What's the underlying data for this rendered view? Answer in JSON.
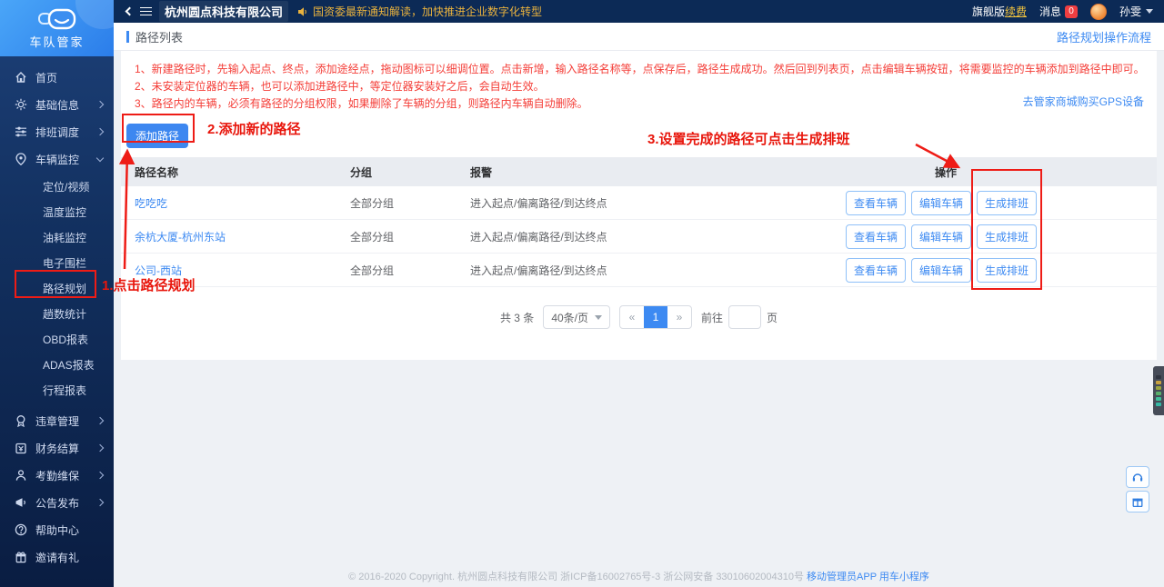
{
  "colors": {
    "accent_blue": "#3d8af2",
    "topbar_navy": "#0c2a56",
    "sidebar_blue": "#12305f",
    "annotation_red": "#ee1c16",
    "tip_red": "#f43d37",
    "marquee_yellow": "#e9b23e",
    "badge_red": "#f03e41"
  },
  "logo": {
    "title": "车队管家"
  },
  "topbar": {
    "company": "杭州圆点科技有限公司",
    "announcement": "国资委最新通知解读，加快推进企业数字化转型",
    "version_label": "旗舰版",
    "renew_link": "续费",
    "messages_label": "消息",
    "messages_count": "0",
    "user_name": "孙雯"
  },
  "sidebar": {
    "items": [
      {
        "label": "首页",
        "icon": "home-icon"
      },
      {
        "label": "基础信息",
        "icon": "gear-icon"
      },
      {
        "label": "排班调度",
        "icon": "sliders-icon"
      },
      {
        "label": "车辆监控",
        "icon": "location-pin-icon"
      },
      {
        "label": "违章管理",
        "icon": "violation-badge-icon"
      },
      {
        "label": "财务结算",
        "icon": "finance-icon"
      },
      {
        "label": "考勤维保",
        "icon": "person-icon"
      },
      {
        "label": "公告发布",
        "icon": "megaphone-icon"
      },
      {
        "label": "帮助中心",
        "icon": "help-icon"
      },
      {
        "label": "邀请有礼",
        "icon": "gift-icon"
      }
    ],
    "vehicle_submenu": [
      "定位/视频",
      "温度监控",
      "油耗监控",
      "电子围栏",
      "路径规划",
      "趟数统计",
      "OBD报表",
      "ADAS报表",
      "行程报表"
    ]
  },
  "page": {
    "title": "路径列表",
    "flow_link": "路径规划操作流程"
  },
  "tips": {
    "line1": "1、新建路径时，先输入起点、终点，添加途经点，拖动图标可以细调位置。点击新增，输入路径名称等，点保存后，路径生成成功。然后回到列表页，点击编辑车辆按钮，将需要监控的车辆添加到路径中即可。",
    "line2": "2、未安装定位器的车辆，也可以添加进路径中，等定位器安装好之后，会自动生效。",
    "line3": "3、路径内的车辆，必须有路径的分组权限，如果删除了车辆的分组，则路径内车辆自动删除。",
    "gps_link": "去管家商城购买GPS设备"
  },
  "toolbar": {
    "add_route": "添加路径"
  },
  "table": {
    "headers": [
      "路径名称",
      "分组",
      "报警",
      "操作"
    ],
    "rows": [
      {
        "name": "吃吃吃",
        "group": "全部分组",
        "alarm": "进入起点/偏离路径/到达终点"
      },
      {
        "name": "余杭大厦-杭州东站",
        "group": "全部分组",
        "alarm": "进入起点/偏离路径/到达终点"
      },
      {
        "name": "公司-西站",
        "group": "全部分组",
        "alarm": "进入起点/偏离路径/到达终点"
      }
    ],
    "actions": {
      "view": "查看车辆",
      "edit": "编辑车辆",
      "schedule": "生成排班"
    }
  },
  "pagination": {
    "total": "共 3 条",
    "page_size": "40条/页",
    "prev": "«",
    "page": "1",
    "next": "»",
    "goto_label": "前往",
    "unit": "页"
  },
  "annotations": {
    "step1": "1.点击路径规划",
    "step2": "2.添加新的路径",
    "step3": "3.设置完成的路径可点击生成排班"
  },
  "footer": {
    "copyright": "© 2016-2020 Copyright. 杭州圆点科技有限公司 浙ICP备16002765号-3 浙公网安备 33010602004310号",
    "app_link": "移动管理员APP",
    "mini_link": "用车小程序"
  }
}
